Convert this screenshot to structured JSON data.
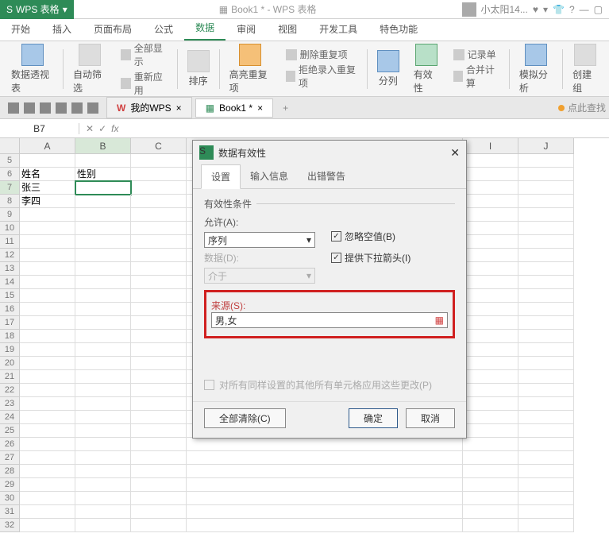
{
  "titlebar": {
    "app_name": "WPS 表格",
    "doc_title": "Book1 * - WPS 表格",
    "user": "小太阳14..."
  },
  "ribbon": {
    "tabs": [
      "开始",
      "插入",
      "页面布局",
      "公式",
      "数据",
      "审阅",
      "视图",
      "开发工具",
      "特色功能"
    ],
    "pivot": "数据透视表",
    "autofilter": "自动筛选",
    "showall": "全部显示",
    "reapply": "重新应用",
    "sort": "排序",
    "highlight_dup": "高亮重复项",
    "delete_dup": "删除重复项",
    "reject_dup": "拒绝录入重复项",
    "split": "分列",
    "validity": "有效性",
    "record": "记录单",
    "consolidate": "合并计算",
    "whatif": "模拟分析",
    "group": "创建组"
  },
  "qat": {
    "mywps": "我的WPS",
    "book": "Book1 *",
    "search_hint": "点此查找"
  },
  "formula": {
    "name_box": "B7",
    "fx": "fx"
  },
  "sheet": {
    "cols_left": [
      "A",
      "B",
      "C"
    ],
    "cols_right": [
      "I",
      "J"
    ],
    "first_row": 5,
    "data": {
      "A6": "姓名",
      "B6": "性别",
      "A7": "张三",
      "A8": "李四"
    },
    "selected_cell": "B7"
  },
  "dialog": {
    "title": "数据有效性",
    "tabs": [
      "设置",
      "输入信息",
      "出错警告"
    ],
    "section": "有效性条件",
    "allow_label": "允许(A):",
    "allow_value": "序列",
    "data_label": "数据(D):",
    "data_value": "介于",
    "source_label": "来源(S):",
    "source_value": "男,女",
    "ignore_blank": "忽略空值(B)",
    "dropdown_arrow": "提供下拉箭头(I)",
    "apply_all": "对所有同样设置的其他所有单元格应用这些更改(P)",
    "clear_all": "全部清除(C)",
    "ok": "确定",
    "cancel": "取消"
  }
}
